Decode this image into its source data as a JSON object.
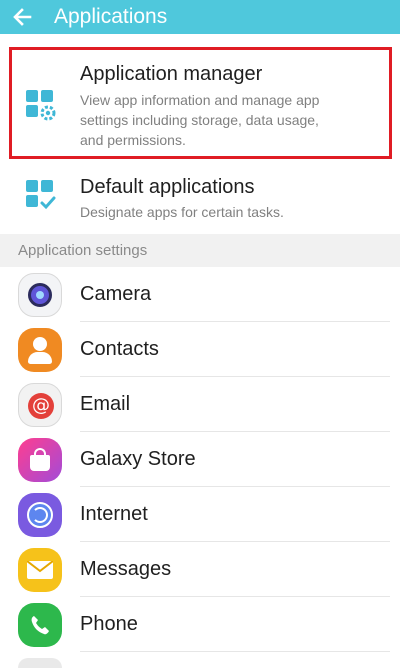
{
  "header": {
    "title": "Applications",
    "back_icon": "back-arrow-icon"
  },
  "items": {
    "app_manager": {
      "title": "Application manager",
      "subtitle_line1": "View app information and manage app",
      "subtitle_line2": "settings including storage, data usage,",
      "subtitle_line3": "and permissions.",
      "icon": "grid-gear-icon"
    },
    "default_apps": {
      "title": "Default applications",
      "subtitle": "Designate apps for certain tasks.",
      "icon": "grid-check-icon"
    }
  },
  "section_header": "Application settings",
  "apps": [
    {
      "label": "Camera",
      "icon": "camera-icon"
    },
    {
      "label": "Contacts",
      "icon": "contacts-icon"
    },
    {
      "label": "Email",
      "icon": "email-icon"
    },
    {
      "label": "Galaxy Store",
      "icon": "galaxy-store-icon"
    },
    {
      "label": "Internet",
      "icon": "internet-icon"
    },
    {
      "label": "Messages",
      "icon": "messages-icon"
    },
    {
      "label": "Phone",
      "icon": "phone-icon"
    }
  ],
  "colors": {
    "header_bg": "#4fc8dc",
    "accent": "#4fc8dc",
    "highlight_border": "#e01c24"
  }
}
